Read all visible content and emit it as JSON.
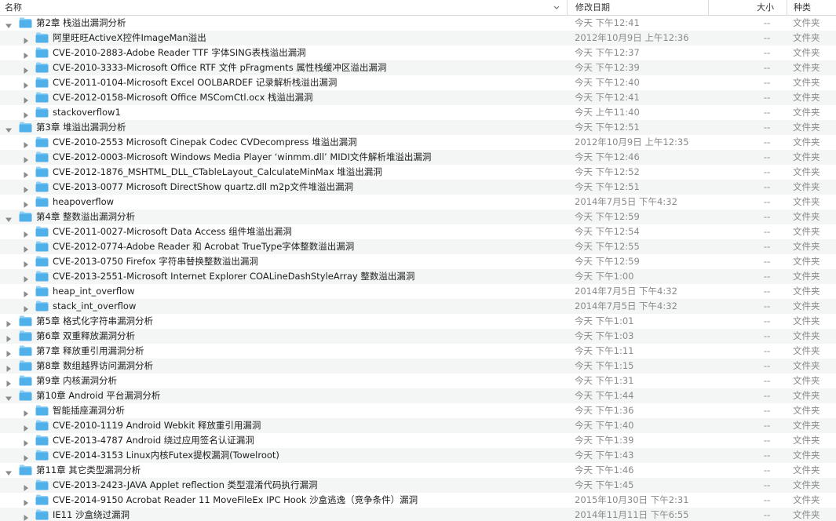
{
  "header": {
    "name_label": "名称",
    "date_label": "修改日期",
    "size_label": "大小",
    "kind_label": "种类"
  },
  "colors": {
    "folder_body": "#4fb0ea",
    "folder_tab": "#8fd0f6",
    "stripe": "#f4f5f5",
    "disclosure": "#8a8a8a"
  },
  "rows": [
    {
      "level": 0,
      "expanded": true,
      "name": "第2章 栈溢出漏洞分析",
      "date": "今天 下午12:41",
      "size": "--",
      "kind": "文件夹"
    },
    {
      "level": 1,
      "expanded": false,
      "name": "阿里旺旺ActiveX控件ImageMan溢出",
      "date": "2012年10月9日 上午12:36",
      "size": "--",
      "kind": "文件夹"
    },
    {
      "level": 1,
      "expanded": false,
      "name": "CVE-2010-2883-Adobe Reader TTF 字体SING表栈溢出漏洞",
      "date": "今天 下午12:37",
      "size": "--",
      "kind": "文件夹"
    },
    {
      "level": 1,
      "expanded": false,
      "name": "CVE-2010-3333-Microsoft Office RTF 文件 pFragments 属性栈缓冲区溢出漏洞",
      "date": "今天 下午12:39",
      "size": "--",
      "kind": "文件夹"
    },
    {
      "level": 1,
      "expanded": false,
      "name": "CVE-2011-0104-Microsoft Excel OOLBARDEF 记录解析栈溢出漏洞",
      "date": "今天 下午12:40",
      "size": "--",
      "kind": "文件夹"
    },
    {
      "level": 1,
      "expanded": false,
      "name": "CVE-2012-0158-Microsoft Office MSComCtl.ocx 栈溢出漏洞",
      "date": "今天 下午12:41",
      "size": "--",
      "kind": "文件夹"
    },
    {
      "level": 1,
      "expanded": false,
      "name": "stackoverflow1",
      "date": "今天 上午11:40",
      "size": "--",
      "kind": "文件夹"
    },
    {
      "level": 0,
      "expanded": true,
      "name": "第3章 堆溢出漏洞分析",
      "date": "今天 下午12:51",
      "size": "--",
      "kind": "文件夹"
    },
    {
      "level": 1,
      "expanded": false,
      "name": "CVE-2010-2553 Microsoft Cinepak Codec CVDecompress 堆溢出漏洞",
      "date": "2012年10月9日 上午12:35",
      "size": "--",
      "kind": "文件夹"
    },
    {
      "level": 1,
      "expanded": false,
      "name": "CVE-2012-0003-Microsoft Windows Media Player ‘winmm.dll’ MIDI文件解析堆溢出漏洞",
      "date": "今天 下午12:46",
      "size": "--",
      "kind": "文件夹"
    },
    {
      "level": 1,
      "expanded": false,
      "name": "CVE-2012-1876_MSHTML_DLL_CTableLayout_CalculateMinMax 堆溢出漏洞",
      "date": "今天 下午12:52",
      "size": "--",
      "kind": "文件夹"
    },
    {
      "level": 1,
      "expanded": false,
      "name": "CVE-2013-0077 Microsoft DirectShow quartz.dll m2p文件堆溢出漏洞",
      "date": "今天 下午12:51",
      "size": "--",
      "kind": "文件夹"
    },
    {
      "level": 1,
      "expanded": false,
      "name": "heapoverflow",
      "date": "2014年7月5日 下午4:32",
      "size": "--",
      "kind": "文件夹"
    },
    {
      "level": 0,
      "expanded": true,
      "name": "第4章 整数溢出漏洞分析",
      "date": "今天 下午12:59",
      "size": "--",
      "kind": "文件夹"
    },
    {
      "level": 1,
      "expanded": false,
      "name": "CVE-2011-0027-Microsoft Data Access 组件堆溢出漏洞",
      "date": "今天 下午12:54",
      "size": "--",
      "kind": "文件夹"
    },
    {
      "level": 1,
      "expanded": false,
      "name": "CVE-2012-0774-Adobe Reader 和 Acrobat TrueType字体整数溢出漏洞",
      "date": "今天 下午12:55",
      "size": "--",
      "kind": "文件夹"
    },
    {
      "level": 1,
      "expanded": false,
      "name": "CVE-2013-0750 Firefox 字符串替换整数溢出漏洞",
      "date": "今天 下午12:59",
      "size": "--",
      "kind": "文件夹"
    },
    {
      "level": 1,
      "expanded": false,
      "name": "CVE-2013-2551-Microsoft Internet Explorer COALineDashStyleArray 整数溢出漏洞",
      "date": "今天 下午1:00",
      "size": "--",
      "kind": "文件夹"
    },
    {
      "level": 1,
      "expanded": false,
      "name": "heap_int_overflow",
      "date": "2014年7月5日 下午4:32",
      "size": "--",
      "kind": "文件夹"
    },
    {
      "level": 1,
      "expanded": false,
      "name": "stack_int_overflow",
      "date": "2014年7月5日 下午4:32",
      "size": "--",
      "kind": "文件夹"
    },
    {
      "level": 0,
      "expanded": false,
      "name": "第5章 格式化字符串漏洞分析",
      "date": "今天 下午1:01",
      "size": "--",
      "kind": "文件夹"
    },
    {
      "level": 0,
      "expanded": false,
      "name": "第6章 双重释放漏洞分析",
      "date": "今天 下午1:03",
      "size": "--",
      "kind": "文件夹"
    },
    {
      "level": 0,
      "expanded": false,
      "name": "第7章 释放重引用漏洞分析",
      "date": "今天 下午1:11",
      "size": "--",
      "kind": "文件夹"
    },
    {
      "level": 0,
      "expanded": false,
      "name": "第8章 数组越界访问漏洞分析",
      "date": "今天 下午1:15",
      "size": "--",
      "kind": "文件夹"
    },
    {
      "level": 0,
      "expanded": false,
      "name": "第9章 内核漏洞分析",
      "date": "今天 下午1:31",
      "size": "--",
      "kind": "文件夹"
    },
    {
      "level": 0,
      "expanded": true,
      "name": "第10章 Android 平台漏洞分析",
      "date": "今天 下午1:44",
      "size": "--",
      "kind": "文件夹"
    },
    {
      "level": 1,
      "expanded": false,
      "name": "智能插座漏洞分析",
      "date": "今天 下午1:36",
      "size": "--",
      "kind": "文件夹"
    },
    {
      "level": 1,
      "expanded": false,
      "name": "CVE-2010-1119 Android Webkit 释放重引用漏洞",
      "date": "今天 下午1:40",
      "size": "--",
      "kind": "文件夹"
    },
    {
      "level": 1,
      "expanded": false,
      "name": "CVE-2013-4787 Android 绕过应用签名认证漏洞",
      "date": "今天 下午1:39",
      "size": "--",
      "kind": "文件夹"
    },
    {
      "level": 1,
      "expanded": false,
      "name": "CVE-2014-3153 Linux内核Futex提权漏洞(Towelroot)",
      "date": "今天 下午1:43",
      "size": "--",
      "kind": "文件夹"
    },
    {
      "level": 0,
      "expanded": true,
      "name": "第11章 其它类型漏洞分析",
      "date": "今天 下午1:46",
      "size": "--",
      "kind": "文件夹"
    },
    {
      "level": 1,
      "expanded": false,
      "name": "CVE-2013-2423-JAVA Applet reflection 类型混淆代码执行漏洞",
      "date": "今天 下午1:45",
      "size": "--",
      "kind": "文件夹"
    },
    {
      "level": 1,
      "expanded": false,
      "name": "CVE-2014-9150 Acrobat Reader 11 MoveFileEx IPC Hook 沙盒逃逸（竞争条件）漏洞",
      "date": "2015年10月30日 下午2:31",
      "size": "--",
      "kind": "文件夹"
    },
    {
      "level": 1,
      "expanded": false,
      "name": "IE11 沙盒绕过漏洞",
      "date": "2014年11月11日 下午6:55",
      "size": "--",
      "kind": "文件夹"
    }
  ]
}
